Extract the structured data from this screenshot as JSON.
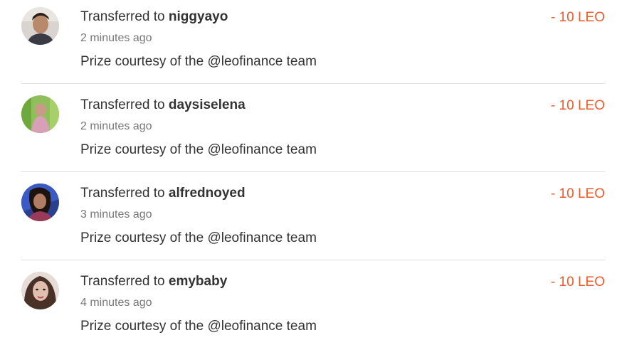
{
  "theme": {
    "amount_color": "#f05a28",
    "text_color": "#333333",
    "muted_color": "#777777"
  },
  "transfers": [
    {
      "prefix": "Transferred to",
      "user": "niggyayo",
      "time": "2 minutes ago",
      "memo": "Prize courtesy of the @leofinance team",
      "amount": "- 10 LEO",
      "avatar_icon": "user-avatar-icon"
    },
    {
      "prefix": "Transferred to",
      "user": "daysiselena",
      "time": "2 minutes ago",
      "memo": "Prize courtesy of the @leofinance team",
      "amount": "- 10 LEO",
      "avatar_icon": "user-avatar-icon"
    },
    {
      "prefix": "Transferred to",
      "user": "alfrednoyed",
      "time": "3 minutes ago",
      "memo": "Prize courtesy of the @leofinance team",
      "amount": "- 10 LEO",
      "avatar_icon": "user-avatar-icon"
    },
    {
      "prefix": "Transferred to",
      "user": "emybaby",
      "time": "4 minutes ago",
      "memo": "Prize courtesy of the @leofinance team",
      "amount": "- 10 LEO",
      "avatar_icon": "user-avatar-icon"
    }
  ]
}
